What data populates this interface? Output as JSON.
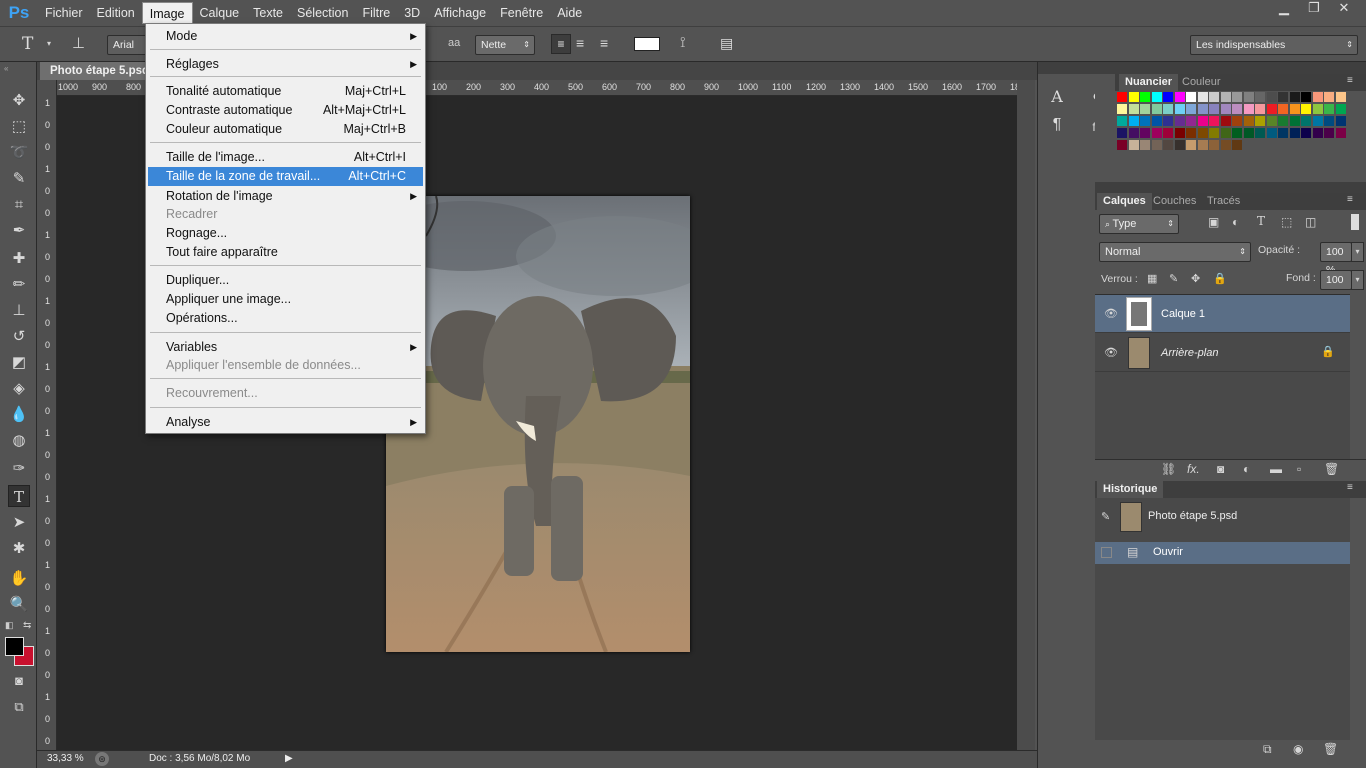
{
  "app": {
    "logo": "Ps"
  },
  "menubar": [
    "Fichier",
    "Edition",
    "Image",
    "Calque",
    "Texte",
    "Sélection",
    "Filtre",
    "3D",
    "Affichage",
    "Fenêtre",
    "Aide"
  ],
  "options": {
    "font": "Arial",
    "aa_label": "aa",
    "aa_mode": "Nette",
    "workspace": "Les indispensables"
  },
  "document": {
    "tab": "Photo étape 5.psd",
    "zoom": "33,33 %",
    "doc_info": "Doc : 3,56 Mo/8,02 Mo"
  },
  "ruler_h": [
    "1000",
    "900",
    "800",
    "700",
    "600",
    "500",
    "400",
    "300",
    "200",
    "100",
    "0",
    "100",
    "200",
    "300",
    "400",
    "500",
    "600",
    "700",
    "800",
    "900",
    "1000",
    "1100",
    "1200",
    "1300",
    "1400",
    "1500",
    "1600",
    "1700",
    "1800"
  ],
  "ruler_v": [
    "1",
    "0",
    "0",
    "1",
    "0",
    "0",
    "1",
    "0",
    "0",
    "1",
    "0",
    "0",
    "1",
    "0",
    "0",
    "1",
    "0",
    "0",
    "1",
    "0",
    "0",
    "1",
    "0",
    "0",
    "1",
    "0",
    "0",
    "1",
    "0",
    "0"
  ],
  "image_menu": {
    "items": [
      {
        "label": "Mode",
        "submenu": true
      },
      {
        "label": "Réglages",
        "submenu": true
      },
      {
        "label": "Tonalité automatique",
        "shortcut": "Maj+Ctrl+L"
      },
      {
        "label": "Contraste automatique",
        "shortcut": "Alt+Maj+Ctrl+L"
      },
      {
        "label": "Couleur automatique",
        "shortcut": "Maj+Ctrl+B"
      },
      {
        "label": "Taille de l'image...",
        "shortcut": "Alt+Ctrl+I"
      },
      {
        "label": "Taille de la zone de travail...",
        "shortcut": "Alt+Ctrl+C",
        "highlighted": true
      },
      {
        "label": "Rotation de l'image",
        "submenu": true
      },
      {
        "label": "Recadrer",
        "disabled": true
      },
      {
        "label": "Rognage..."
      },
      {
        "label": "Tout faire apparaître"
      },
      {
        "label": "Dupliquer..."
      },
      {
        "label": "Appliquer une image..."
      },
      {
        "label": "Opérations..."
      },
      {
        "label": "Variables",
        "submenu": true
      },
      {
        "label": "Appliquer l'ensemble de données...",
        "disabled": true
      },
      {
        "label": "Recouvrement...",
        "disabled": true
      },
      {
        "label": "Analyse",
        "submenu": true
      }
    ]
  },
  "swatches_panel": {
    "tabs": [
      "Nuancier",
      "Couleur"
    ]
  },
  "layers_panel": {
    "tabs": [
      "Calques",
      "Couches",
      "Tracés"
    ],
    "filter": "Type",
    "blend_mode": "Normal",
    "opacity_label": "Opacité :",
    "opacity": "100 %",
    "lock_label": "Verrou :",
    "fill_label": "Fond :",
    "fill": "100 %",
    "layers": [
      {
        "name": "Calque 1",
        "selected": true
      },
      {
        "name": "Arrière-plan",
        "locked": true
      }
    ]
  },
  "history_panel": {
    "tab": "Historique",
    "snapshot": "Photo étape 5.psd",
    "steps": [
      "Ouvrir"
    ]
  },
  "colors": {
    "fg": "#000000",
    "bg": "#c8102e",
    "highlight": "#3b87d8",
    "selected_layer": "#5a6e86"
  }
}
